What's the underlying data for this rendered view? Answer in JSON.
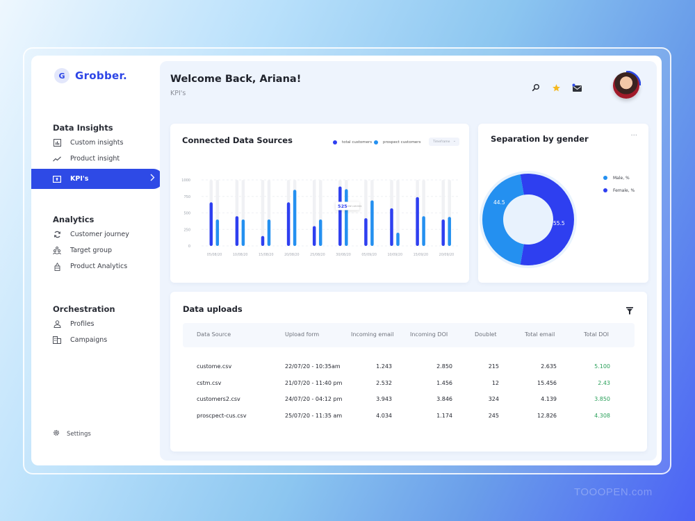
{
  "app": {
    "brand_letter": "G",
    "brand_name": "Grobber.",
    "watermark": "TOOOPEN.com"
  },
  "sidebar": {
    "sections": [
      {
        "heading": "Data Insights",
        "items": [
          {
            "label": "Custom insights",
            "icon": "bar-chart-icon"
          },
          {
            "label": "Product insight",
            "icon": "trend-line-icon"
          },
          {
            "label": "KPI's",
            "icon": "kpi-screen-icon",
            "active": true
          }
        ]
      },
      {
        "heading": "Analytics",
        "items": [
          {
            "label": "Customer journey",
            "icon": "refresh-icon"
          },
          {
            "label": "Target group",
            "icon": "group-icon"
          },
          {
            "label": "Product Analytics",
            "icon": "product-icon"
          }
        ]
      },
      {
        "heading": "Orchestration",
        "items": [
          {
            "label": "Profiles",
            "icon": "user-icon"
          },
          {
            "label": "Campaigns",
            "icon": "building-icon"
          }
        ]
      }
    ],
    "settings_label": "Settings"
  },
  "header": {
    "welcome": "Welcome Back, Ariana!",
    "subtitle": "KPI's",
    "icons": [
      "search-icon",
      "star-icon",
      "mail-icon"
    ],
    "star_color": "#f5b921",
    "notification_color": "#2e4ae6"
  },
  "connected_sources": {
    "title": "Connected Data Sources",
    "legend": [
      {
        "label": "total customers",
        "color": "#2e3ff0"
      },
      {
        "label": "prospect customers",
        "color": "#2490f0"
      }
    ],
    "dropdown_value": "Timeframe",
    "tooltip": {
      "value": "525",
      "label": "total customers"
    }
  },
  "gender": {
    "title": "Separation by gender",
    "more_label": "···"
  },
  "uploads": {
    "title": "Data uploads",
    "columns": [
      "Data Source",
      "Upload form",
      "Incoming email",
      "Incoming DOI",
      "Doublet",
      "Total email",
      "Total DOI"
    ],
    "rows": [
      [
        "custome.csv",
        "22/07/20 - 10:35am",
        "1.243",
        "2.850",
        "215",
        "2.635",
        "5.100"
      ],
      [
        "cstm.csv",
        "21/07/20 - 11:40 pm",
        "2.532",
        "1.456",
        "12",
        "15.456",
        "2.43"
      ],
      [
        "customers2.csv",
        "24/07/20 - 04:12 pm",
        "3.943",
        "3.846",
        "324",
        "4.139",
        "3.850"
      ],
      [
        "proscpect-cus.csv",
        "25/07/20 - 11:35 am",
        "4.034",
        "1.174",
        "245",
        "12.826",
        "4.308"
      ]
    ],
    "accent_green": "#2aa05a"
  },
  "chart_data": [
    {
      "type": "bar",
      "title": "Connected Data Sources",
      "categories": [
        "05/08/20",
        "10/08/20",
        "15/08/20",
        "20/08/20",
        "25/08/20",
        "30/08/20",
        "05/09/20",
        "10/09/20",
        "15/09/20",
        "20/09/20"
      ],
      "series": [
        {
          "name": "total customers",
          "color": "#2e3ff0",
          "values": [
            660,
            450,
            150,
            660,
            300,
            900,
            420,
            570,
            740,
            400
          ]
        },
        {
          "name": "prospect customers",
          "color": "#2490f0",
          "values": [
            400,
            400,
            400,
            850,
            400,
            860,
            690,
            200,
            450,
            440
          ]
        }
      ],
      "yticks": [
        0,
        250,
        500,
        750,
        1000
      ],
      "ylim": [
        0,
        1000
      ],
      "grid": true,
      "xlabel": "",
      "ylabel": "",
      "legend": "top-right"
    },
    {
      "type": "pie",
      "title": "Separation by gender",
      "labels": [
        "Male, %",
        "Female, %"
      ],
      "values": [
        44.5,
        55.5
      ],
      "colors": [
        "#2490f0",
        "#2e3ff0"
      ],
      "donut": true,
      "legend": "right"
    }
  ]
}
